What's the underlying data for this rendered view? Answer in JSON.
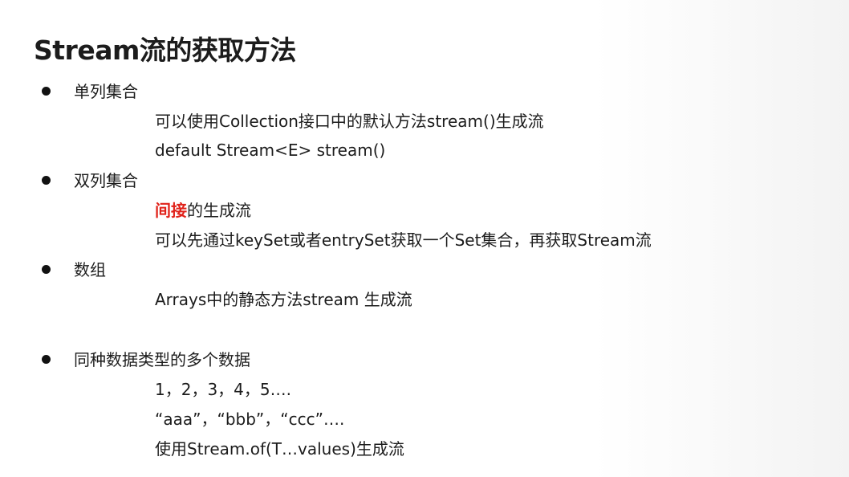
{
  "title": "Stream流的获取方法",
  "sections": [
    {
      "heading": "单列集合",
      "lines": [
        "可以使用Collection接口中的默认方法stream()生成流",
        "default Stream<E> stream()"
      ]
    },
    {
      "heading": "双列集合",
      "highlight_line": {
        "highlight": "间接",
        "rest": "的生成流"
      },
      "lines": [
        "可以先通过keySet或者entrySet获取一个Set集合，再获取Stream流"
      ]
    },
    {
      "heading": "数组",
      "lines": [
        "Arrays中的静态方法stream 生成流"
      ]
    },
    {
      "heading": "同种数据类型的多个数据",
      "lines": [
        "1，2，3，4，5….",
        "“aaa”，“bbb”，“ccc”….",
        "使用Stream.of(T…values)生成流"
      ]
    }
  ],
  "colors": {
    "highlight": "#e0221a",
    "text": "#1c1c1c",
    "background": "#ffffff"
  }
}
